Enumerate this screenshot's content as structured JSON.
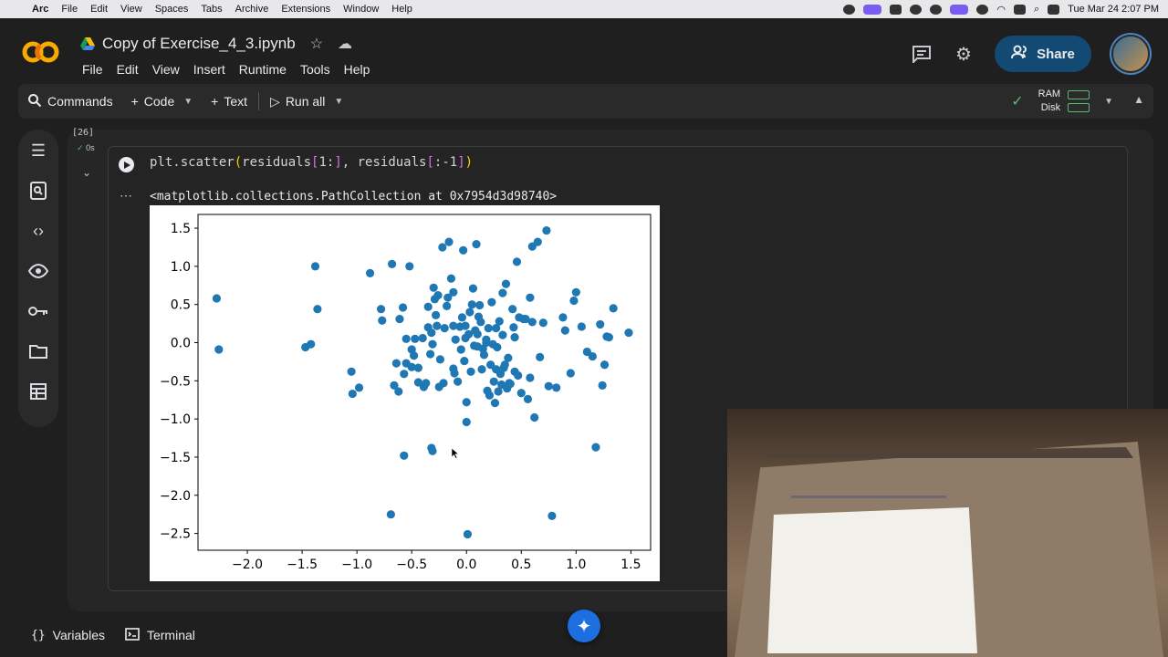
{
  "menubar": {
    "app": "Arc",
    "items": [
      "File",
      "Edit",
      "View",
      "Spaces",
      "Tabs",
      "Archive",
      "Extensions",
      "Window",
      "Help"
    ],
    "clock": "Tue Mar 24  2:07 PM"
  },
  "header": {
    "title": "Copy of Exercise_4_3.ipynb",
    "menus": [
      "File",
      "Edit",
      "View",
      "Insert",
      "Runtime",
      "Tools",
      "Help"
    ],
    "share_label": "Share"
  },
  "toolbar": {
    "commands_label": "Commands",
    "code_label": "Code",
    "text_label": "Text",
    "run_all_label": "Run all",
    "ram_label": "RAM",
    "disk_label": "Disk"
  },
  "rail": [
    "table-of-contents-icon",
    "find-replace-icon",
    "code-snippets-icon",
    "variable-inspector-icon",
    "secrets-key-icon",
    "files-folder-icon",
    "data-table-icon"
  ],
  "cell": {
    "exec_count": "[26]",
    "exec_time": "0s",
    "code_prefix": "plt.scatter",
    "code_p1": "(",
    "code_a1": "residuals",
    "code_b1": "[",
    "code_s1": "1:",
    "code_b2": "]",
    "code_mid": ", residuals",
    "code_b3": "[",
    "code_s2": ":-1",
    "code_b4": "]",
    "code_p2": ")",
    "output_text": "<matplotlib.collections.PathCollection at 0x7954d3d98740>"
  },
  "chart_data": {
    "type": "scatter",
    "color": "#1f77b4",
    "xlim": [
      -2.45,
      1.68
    ],
    "ylim": [
      -2.72,
      1.68
    ],
    "x_ticks": [
      "−2.0",
      "−1.5",
      "−1.0",
      "−0.5",
      "0.0",
      "0.5",
      "1.0",
      "1.5"
    ],
    "x_tick_values": [
      -2.0,
      -1.5,
      -1.0,
      -0.5,
      0.0,
      0.5,
      1.0,
      1.5
    ],
    "y_ticks": [
      "1.5",
      "1.0",
      "0.5",
      "0.0",
      "−0.5",
      "−1.0",
      "−1.5",
      "−2.0",
      "−2.5"
    ],
    "y_tick_values": [
      1.5,
      1.0,
      0.5,
      0.0,
      -0.5,
      -1.0,
      -1.5,
      -2.0,
      -2.5
    ],
    "points": [
      [
        -2.28,
        0.58
      ],
      [
        -2.26,
        -0.09
      ],
      [
        -1.47,
        -0.06
      ],
      [
        -1.42,
        -0.02
      ],
      [
        -1.38,
        1.0
      ],
      [
        -1.36,
        0.44
      ],
      [
        -1.05,
        -0.38
      ],
      [
        -1.04,
        -0.67
      ],
      [
        -0.98,
        -0.59
      ],
      [
        -0.88,
        0.91
      ],
      [
        -0.78,
        0.44
      ],
      [
        -0.77,
        0.29
      ],
      [
        -0.68,
        1.03
      ],
      [
        -0.66,
        -0.56
      ],
      [
        -0.64,
        -0.27
      ],
      [
        -0.62,
        -0.64
      ],
      [
        -0.61,
        0.31
      ],
      [
        -0.58,
        0.46
      ],
      [
        -0.57,
        -0.41
      ],
      [
        -0.55,
        0.05
      ],
      [
        -0.55,
        -0.27
      ],
      [
        -0.52,
        1.0
      ],
      [
        -0.5,
        -0.32
      ],
      [
        -0.5,
        -0.09
      ],
      [
        -0.48,
        -0.17
      ],
      [
        -0.47,
        0.05
      ],
      [
        -0.44,
        -0.33
      ],
      [
        -0.4,
        0.06
      ],
      [
        -0.39,
        -0.58
      ],
      [
        -0.37,
        -0.53
      ],
      [
        -0.35,
        0.47
      ],
      [
        -0.35,
        0.2
      ],
      [
        -0.33,
        -0.15
      ],
      [
        -0.32,
        0.13
      ],
      [
        -0.31,
        -0.02
      ],
      [
        -0.3,
        0.72
      ],
      [
        -0.29,
        0.57
      ],
      [
        -0.28,
        0.36
      ],
      [
        -0.27,
        0.22
      ],
      [
        -0.26,
        0.62
      ],
      [
        -0.24,
        -0.22
      ],
      [
        -0.22,
        1.25
      ],
      [
        -0.21,
        -0.53
      ],
      [
        -0.2,
        0.19
      ],
      [
        -0.18,
        0.48
      ],
      [
        -0.16,
        1.32
      ],
      [
        -0.14,
        0.84
      ],
      [
        -0.12,
        -0.34
      ],
      [
        -0.12,
        0.22
      ],
      [
        -0.1,
        0.04
      ],
      [
        -0.08,
        -0.51
      ],
      [
        -0.06,
        0.21
      ],
      [
        -0.05,
        -0.09
      ],
      [
        -0.04,
        0.33
      ],
      [
        -0.03,
        1.21
      ],
      [
        -0.02,
        -0.24
      ],
      [
        -0.01,
        0.06
      ],
      [
        0.0,
        -0.78
      ],
      [
        0.02,
        0.11
      ],
      [
        0.03,
        0.4
      ],
      [
        0.04,
        -0.38
      ],
      [
        0.05,
        0.5
      ],
      [
        0.06,
        0.71
      ],
      [
        0.07,
        -0.04
      ],
      [
        0.08,
        0.16
      ],
      [
        0.09,
        1.29
      ],
      [
        0.1,
        -0.05
      ],
      [
        0.11,
        0.34
      ],
      [
        0.12,
        0.49
      ],
      [
        0.13,
        0.27
      ],
      [
        0.14,
        -0.35
      ],
      [
        0.15,
        -0.08
      ],
      [
        0.16,
        -0.16
      ],
      [
        0.18,
        0.04
      ],
      [
        0.19,
        -0.63
      ],
      [
        0.2,
        0.19
      ],
      [
        0.21,
        -0.69
      ],
      [
        0.22,
        -0.29
      ],
      [
        0.23,
        0.53
      ],
      [
        0.24,
        -0.02
      ],
      [
        0.25,
        -0.51
      ],
      [
        0.26,
        -0.79
      ],
      [
        0.27,
        -0.35
      ],
      [
        0.28,
        -0.06
      ],
      [
        0.29,
        -0.64
      ],
      [
        0.3,
        0.28
      ],
      [
        0.31,
        -0.41
      ],
      [
        0.32,
        -0.55
      ],
      [
        0.33,
        0.65
      ],
      [
        0.34,
        -0.33
      ],
      [
        0.35,
        -0.29
      ],
      [
        0.36,
        0.77
      ],
      [
        0.37,
        -0.6
      ],
      [
        0.38,
        -0.2
      ],
      [
        0.4,
        -0.54
      ],
      [
        0.42,
        0.44
      ],
      [
        0.43,
        0.2
      ],
      [
        0.44,
        -0.38
      ],
      [
        0.46,
        1.06
      ],
      [
        0.48,
        0.33
      ],
      [
        0.5,
        -0.66
      ],
      [
        0.52,
        0.31
      ],
      [
        0.54,
        0.31
      ],
      [
        0.56,
        -0.74
      ],
      [
        0.58,
        0.59
      ],
      [
        0.6,
        0.27
      ],
      [
        0.62,
        -0.98
      ],
      [
        0.65,
        1.32
      ],
      [
        0.67,
        -0.19
      ],
      [
        0.7,
        0.26
      ],
      [
        0.73,
        1.47
      ],
      [
        0.75,
        -0.57
      ],
      [
        0.78,
        -2.27
      ],
      [
        0.82,
        -0.59
      ],
      [
        0.88,
        0.33
      ],
      [
        0.9,
        0.16
      ],
      [
        0.95,
        -0.4
      ],
      [
        0.98,
        0.55
      ],
      [
        1.0,
        0.66
      ],
      [
        1.05,
        0.21
      ],
      [
        1.1,
        -0.12
      ],
      [
        1.15,
        -0.18
      ],
      [
        1.18,
        -1.37
      ],
      [
        1.22,
        0.24
      ],
      [
        1.24,
        -0.56
      ],
      [
        1.26,
        -0.29
      ],
      [
        1.28,
        0.08
      ],
      [
        1.3,
        0.07
      ],
      [
        1.34,
        0.45
      ],
      [
        1.48,
        0.13
      ],
      [
        -0.57,
        -1.48
      ],
      [
        -0.32,
        -1.38
      ],
      [
        -0.31,
        -1.42
      ],
      [
        -0.69,
        -2.25
      ],
      [
        0.01,
        -2.51
      ],
      [
        -0.17,
        0.59
      ],
      [
        0.18,
        0.0
      ],
      [
        0.1,
        0.11
      ],
      [
        -0.12,
        0.66
      ],
      [
        0.39,
        -0.53
      ],
      [
        -0.44,
        -0.52
      ],
      [
        0.0,
        -1.04
      ],
      [
        -0.11,
        -0.4
      ],
      [
        0.27,
        0.19
      ],
      [
        0.47,
        -0.43
      ],
      [
        0.58,
        -0.46
      ],
      [
        -0.01,
        0.22
      ],
      [
        0.33,
        0.1
      ],
      [
        0.6,
        1.26
      ],
      [
        -0.25,
        -0.58
      ],
      [
        0.44,
        0.07
      ]
    ]
  },
  "bottom": {
    "variables_label": "Variables",
    "terminal_label": "Terminal"
  }
}
